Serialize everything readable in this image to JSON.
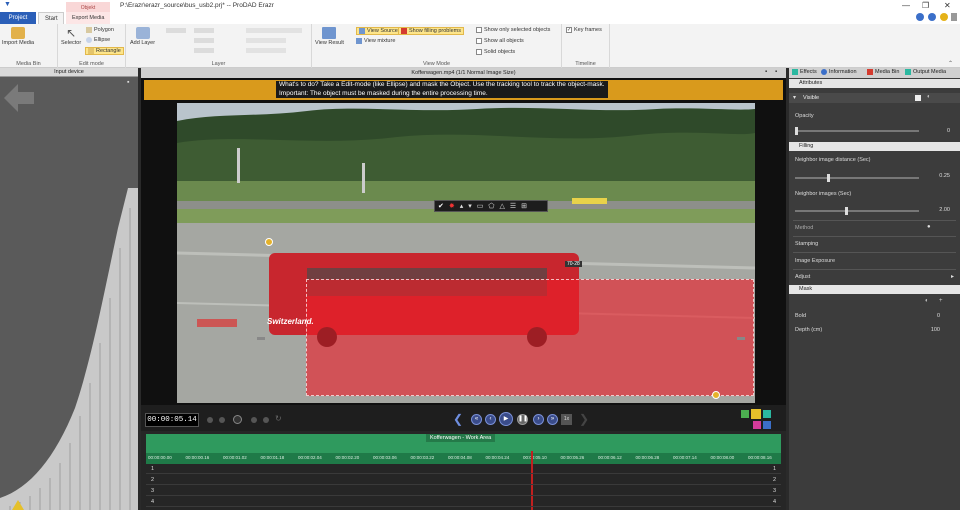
{
  "window": {
    "path": "P:\\Erazr\\erazr_source\\bus_usb2.prj* -- ProDAD Erazr",
    "min": "—",
    "max": "❐",
    "close": "✕"
  },
  "tabs": {
    "project": "Project",
    "start": "Start",
    "context_header": "Objekt",
    "export": "Export Media"
  },
  "ribbon": {
    "import_media": "Import Media",
    "media_bin": "Media Bin",
    "selector": "Selector",
    "polygon": "Polygon",
    "ellipse": "Ellipse",
    "rectangle": "Rectangle",
    "edit_mode": "Edit mode",
    "add_layer": "Add Layer",
    "layer": "Layer",
    "view_result": "View Result",
    "view_source": "View Source",
    "view_mixture": "View mixture",
    "show_filling": "Show filling problems",
    "show_selected": "Show only selected objects",
    "show_all": "Show all objects",
    "solid_objects": "Solid objects",
    "view_mode": "View Mode",
    "key_frames": "Key frames",
    "timeline": "Timeline"
  },
  "left_panel": {
    "title": "Input device"
  },
  "viewer": {
    "header": "Kofferwagen.mp4  (1/1  Normal Image Size)",
    "banner_line1": "What's to do?  Take a Edit-mode (like Ellipse) and mask the Object. Use the tracking tool to track the object-mask.",
    "banner_line2": "Important: The object must be masked during the entire processing time.",
    "bus_text": "Switzerland.",
    "tag_text": "70-28"
  },
  "transport": {
    "timecode": "00:00:05.14",
    "speed": "1x"
  },
  "timeline": {
    "work_area": "Kofferwagen - Work Area",
    "ticks": [
      "00:00:00.00",
      "00:00:00.16",
      "00:00:01.02",
      "00:00:01.18",
      "00:00:02.04",
      "00:00:02.20",
      "00:00:03.06",
      "00:00:03.22",
      "00:00:04.08",
      "00:00:04.24",
      "00:00:05.10",
      "00:00:05.26",
      "00:00:06.12",
      "00:00:06.28",
      "00:00:07.14",
      "00:00:08.00",
      "00:00:08.16"
    ],
    "rows": [
      "1",
      "2",
      "3",
      "4"
    ]
  },
  "right_panel": {
    "tab_effects": "Effects",
    "tab_information": "Information",
    "tab_media_bin": "Media Bin",
    "tab_output": "Output Media",
    "attributes": "Attributes",
    "visible": "Visible",
    "opacity": "Opacity",
    "opacity_val": "0",
    "filling": "Filling",
    "neighbor_distance": "Neighbor image distance (Sec)",
    "neighbor_distance_val": "0.25",
    "neighbor_images": "Neighbor images (Sec)",
    "neighbor_images_val": "2.00",
    "method": "Method",
    "stamping": "Stamping",
    "image_exposure": "Image Exposure",
    "adjust": "Adjust",
    "mask": "Mask",
    "bold": "Bold",
    "bold_val": "0",
    "depth": "Depth (cm)",
    "depth_val": "100"
  }
}
